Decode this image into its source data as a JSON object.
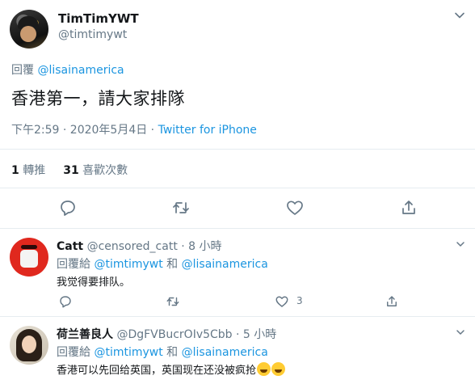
{
  "main_tweet": {
    "display_name": "TimTimYWT",
    "handle": "@timtimywt",
    "replying_prefix": "回覆",
    "replying_to": "@lisainamerica",
    "text": "香港第一，請大家排隊",
    "timestamp": "下午2:59 · 2020年5月4日 · ",
    "source": "Twitter for iPhone",
    "retweets_count": "1",
    "retweets_label": "轉推",
    "likes_count": "31",
    "likes_label": "喜歡次數"
  },
  "replies": [
    {
      "display_name": "Catt",
      "handle": "@censored_catt",
      "time": " · 8 小時",
      "replying_prefix": "回覆給 ",
      "replying_to_1": "@timtimywt",
      "replying_and": " 和 ",
      "replying_to_2": "@lisainamerica",
      "text": "我觉得要排队。",
      "like_count": "3"
    },
    {
      "display_name": "荷兰善良人",
      "handle": "@DgFVBucrOIv5Cbb",
      "time": " · 5 小時",
      "replying_prefix": "回覆給 ",
      "replying_to_1": "@timtimywt",
      "replying_and": " 和 ",
      "replying_to_2": "@lisainamerica",
      "text": "香港可以先回给英国，英国现在还没被疯抢",
      "emojis": [
        "grinning-sweat-emoji",
        "grinning-sweat-emoji"
      ]
    }
  ],
  "icons": {
    "reply": "reply-icon",
    "retweet": "retweet-icon",
    "like": "heart-icon",
    "share": "share-icon",
    "more": "chevron-down-icon"
  },
  "colors": {
    "link": "#1b95e0",
    "muted": "#657786",
    "text": "#14171a",
    "divider": "#e6ecf0"
  }
}
